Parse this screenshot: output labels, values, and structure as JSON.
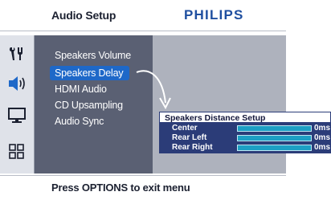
{
  "header": {
    "title": "Audio Setup",
    "brand": "PHILIPS"
  },
  "sidebar": {
    "icons": [
      "tools-icon",
      "speaker-icon",
      "monitor-icon",
      "grid-icon"
    ]
  },
  "menu": {
    "items": [
      {
        "label": "Speakers Volume"
      },
      {
        "label": "Speakers Delay",
        "selected": true
      },
      {
        "label": "HDMI Audio"
      },
      {
        "label": "CD Upsampling"
      },
      {
        "label": "Audio Sync"
      }
    ]
  },
  "dialog": {
    "title": "Speakers Distance Setup",
    "rows": [
      {
        "label": "Center",
        "value": "0ms"
      },
      {
        "label": "Rear Left",
        "value": "0ms"
      },
      {
        "label": "Rear Right",
        "value": "0ms"
      }
    ]
  },
  "footer": {
    "hint": "Press OPTIONS to exit menu"
  },
  "colors": {
    "selection": "#1e68c8",
    "menu_bg": "#5a6073",
    "dialog_bg": "#2b3c78",
    "bar": "#1d9fc4",
    "brand": "#1f4fa0"
  }
}
